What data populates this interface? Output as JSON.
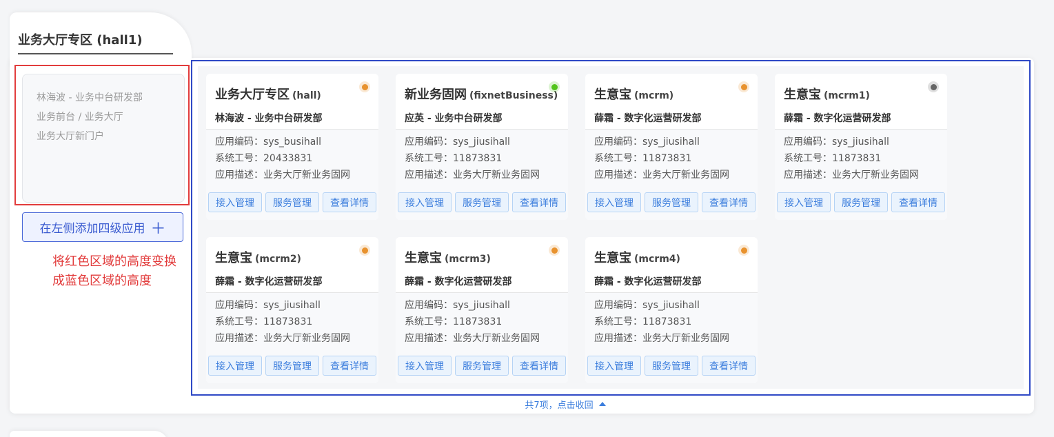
{
  "hall": {
    "title": "业务大厅专区 (hall1)"
  },
  "left_card": {
    "lines": [
      "林海波 - 业务中台研发部",
      "业务前台 / 业务大厅",
      "业务大厅新门户"
    ]
  },
  "add_button": {
    "label": "在左侧添加四级应用",
    "icon": "＋"
  },
  "annotation": {
    "line1": "将红色区域的高度变换",
    "line2": "成蓝色区域的高度"
  },
  "labels": {
    "code": "应用编码：",
    "staff": "系统工号：",
    "desc": "应用描述："
  },
  "actions": [
    "接入管理",
    "服务管理",
    "查看详情"
  ],
  "status_colors": {
    "orange": "#e8922e",
    "green": "#52c41a",
    "gray": "#666666"
  },
  "cards": [
    {
      "name": "业务大厅专区",
      "code_tag": "(hall)",
      "owner": "林海波 - 业务中台研发部",
      "app_code": "sys_busihall",
      "staff_no": "20433831",
      "desc": "业务大厅新业务固网",
      "status": "orange"
    },
    {
      "name": "新业务固网",
      "code_tag": "(fixnetBusiness)",
      "owner": "应英 - 业务中台研发部",
      "app_code": "sys_jiusihall",
      "staff_no": "11873831",
      "desc": "业务大厅新业务固网",
      "status": "green"
    },
    {
      "name": "生意宝",
      "code_tag": "(mcrm)",
      "owner": "薛霜 - 数字化运营研发部",
      "app_code": "sys_jiusihall",
      "staff_no": "11873831",
      "desc": "业务大厅新业务固网",
      "status": "orange"
    },
    {
      "name": "生意宝",
      "code_tag": "(mcrm1)",
      "owner": "薛霜 - 数字化运营研发部",
      "app_code": "sys_jiusihall",
      "staff_no": "11873831",
      "desc": "业务大厅新业务固网",
      "status": "gray"
    },
    {
      "name": "生意宝",
      "code_tag": "(mcrm2)",
      "owner": "薛霜 - 数字化运营研发部",
      "app_code": "sys_jiusihall",
      "staff_no": "11873831",
      "desc": "业务大厅新业务固网",
      "status": "orange"
    },
    {
      "name": "生意宝",
      "code_tag": "(mcrm3)",
      "owner": "薛霜 - 数字化运营研发部",
      "app_code": "sys_jiusihall",
      "staff_no": "11873831",
      "desc": "业务大厅新业务固网",
      "status": "orange"
    },
    {
      "name": "生意宝",
      "code_tag": "(mcrm4)",
      "owner": "薛霜 - 数字化运营研发部",
      "app_code": "sys_jiusihall",
      "staff_no": "11873831",
      "desc": "业务大厅新业务固网",
      "status": "orange"
    }
  ],
  "collapse": {
    "label": "共7项，点击收回"
  }
}
